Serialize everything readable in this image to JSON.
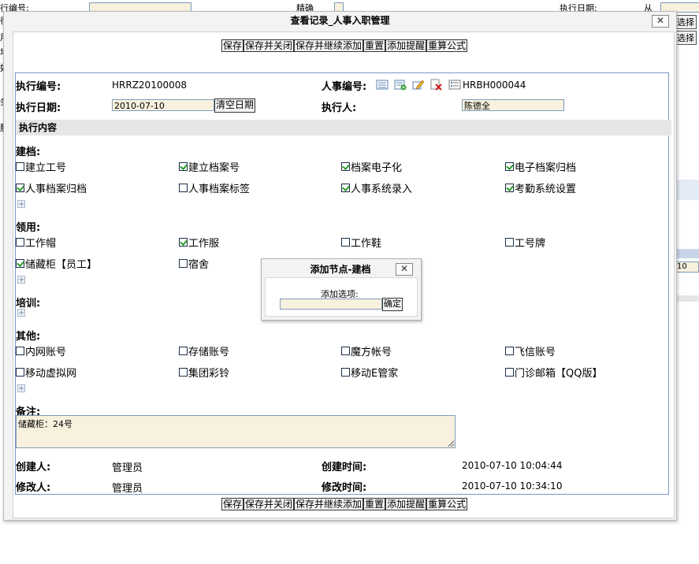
{
  "background": {
    "left_label_1": "行编号:",
    "left_label_2": "行",
    "left_label_3": "用",
    "left_label_4": "地",
    "left_label_5": "奴",
    "left_label_6": "务",
    "left_label_7": "脂",
    "match_label": "精确",
    "date_label": "执行日期:",
    "from_label": "从",
    "select_btn_1": "选择",
    "select_btn_2": "选择",
    "page_size": "10"
  },
  "dialog": {
    "title": "查看记录_人事入职管理",
    "close": "✕",
    "toolbar": [
      "保存",
      "保存并关闭",
      "保存并继续添加",
      "重置",
      "添加提醒",
      "重算公式"
    ]
  },
  "form": {
    "exec_no_label": "执行编号:",
    "exec_no_value": "HRRZ20100008",
    "hr_no_label": "人事编号:",
    "hr_no_value": "HRBH000044",
    "exec_date_label": "执行日期:",
    "exec_date_value": "2010-07-10",
    "clear_date_btn": "清空日期",
    "executor_label": "执行人:",
    "executor_value": "陈德全",
    "section_title": "执行内容",
    "groups": [
      {
        "title": "建档:",
        "items": [
          {
            "label": "建立工号",
            "checked": false
          },
          {
            "label": "建立档案号",
            "checked": true
          },
          {
            "label": "档案电子化",
            "checked": true
          },
          {
            "label": "电子档案归档",
            "checked": true
          },
          {
            "label": "人事档案归档",
            "checked": true
          },
          {
            "label": "人事档案标签",
            "checked": false
          },
          {
            "label": "人事系统录入",
            "checked": true
          },
          {
            "label": "考勤系统设置",
            "checked": true
          }
        ]
      },
      {
        "title": "领用:",
        "items": [
          {
            "label": "工作帽",
            "checked": false
          },
          {
            "label": "工作服",
            "checked": true
          },
          {
            "label": "工作鞋",
            "checked": false
          },
          {
            "label": "工号牌",
            "checked": false
          },
          {
            "label": "储藏柜【员工】",
            "checked": true
          },
          {
            "label": "宿舍",
            "checked": false
          }
        ]
      },
      {
        "title": "培训:",
        "items": []
      },
      {
        "title": "其他:",
        "items": [
          {
            "label": "内网账号",
            "checked": false
          },
          {
            "label": "存储账号",
            "checked": false
          },
          {
            "label": "魔方帐号",
            "checked": false
          },
          {
            "label": "飞信账号",
            "checked": false
          },
          {
            "label": "移动虚拟网",
            "checked": false
          },
          {
            "label": "集团彩铃",
            "checked": false
          },
          {
            "label": "移动E管家",
            "checked": false
          },
          {
            "label": "门诊邮箱【QQ版】",
            "checked": false
          }
        ]
      }
    ],
    "remark_label": "备注:",
    "remark_value": "储藏柜：24号",
    "creator_label": "创建人:",
    "creator_value": "管理员",
    "create_time_label": "创建时间:",
    "create_time_value": "2010-07-10 10:04:44",
    "modifier_label": "修改人:",
    "modifier_value": "管理员",
    "modify_time_label": "修改时间:",
    "modify_time_value": "2010-07-10 10:34:10"
  },
  "popup": {
    "title": "添加节点-建档",
    "close": "✕",
    "field_label": "添加选项:",
    "confirm_btn": "确定"
  },
  "colors": {
    "input_bg": "#f7f1de",
    "panel_border": "#7a95c8",
    "check_green": "#2a9a2a"
  }
}
